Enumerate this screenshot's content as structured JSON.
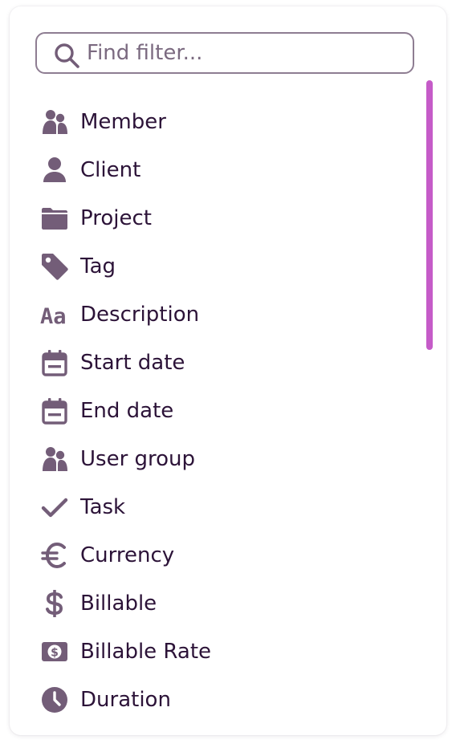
{
  "search": {
    "placeholder": "Find filter...",
    "value": ""
  },
  "filters": [
    {
      "label": "Member",
      "icon": "users-icon"
    },
    {
      "label": "Client",
      "icon": "user-icon"
    },
    {
      "label": "Project",
      "icon": "folder-icon"
    },
    {
      "label": "Tag",
      "icon": "tag-icon"
    },
    {
      "label": "Description",
      "icon": "text-icon"
    },
    {
      "label": "Start date",
      "icon": "calendar-icon"
    },
    {
      "label": "End date",
      "icon": "calendar-icon"
    },
    {
      "label": "User group",
      "icon": "users-icon"
    },
    {
      "label": "Task",
      "icon": "check-icon"
    },
    {
      "label": "Currency",
      "icon": "euro-icon"
    },
    {
      "label": "Billable",
      "icon": "dollar-icon"
    },
    {
      "label": "Billable Rate",
      "icon": "money-icon"
    },
    {
      "label": "Duration",
      "icon": "clock-icon"
    }
  ],
  "colors": {
    "text": "#2c1338",
    "icon": "#735d78",
    "border": "#8e7d92",
    "scrollbar": "#c55bc8"
  }
}
